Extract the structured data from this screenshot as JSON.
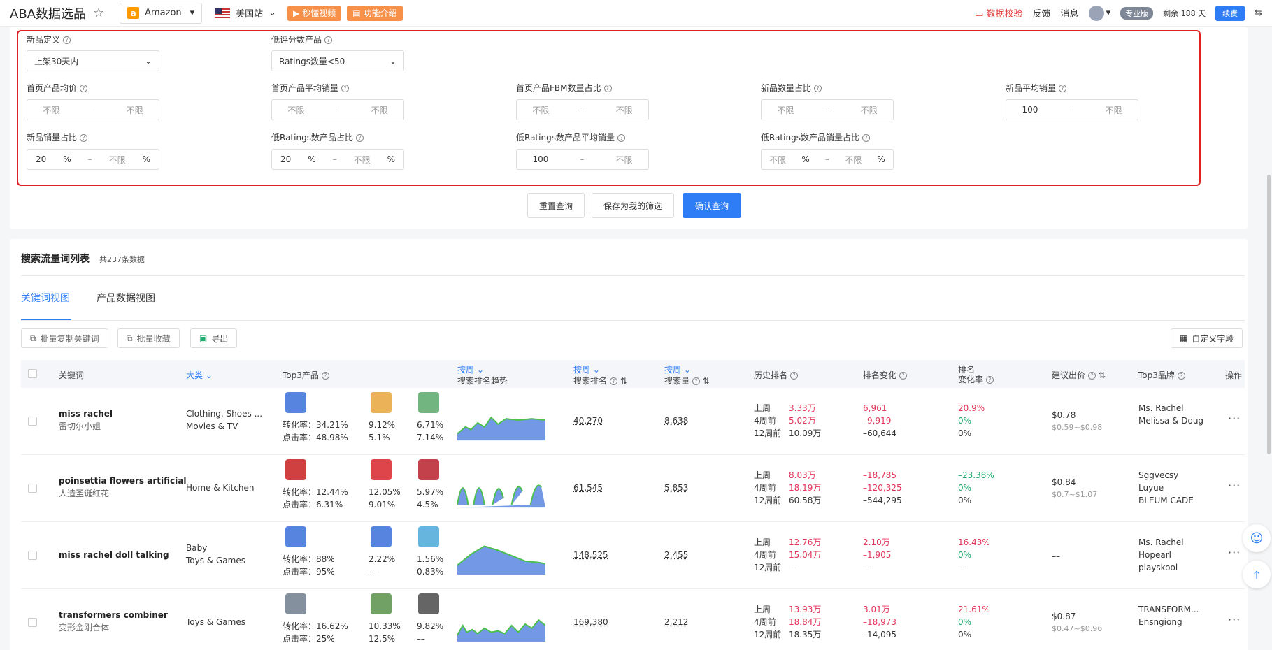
{
  "header": {
    "title": "ABA数据选品",
    "platform": "Amazon",
    "site": "美国站",
    "video_btn": "秒懂视频",
    "intro_btn": "功能介绍",
    "data_check": "数据校验",
    "feedback": "反馈",
    "messages": "消息",
    "plan": "专业版",
    "remaining": "剩余 188 天",
    "renew": "续费"
  },
  "filters": {
    "new_def_label": "新品定义",
    "new_def_value": "上架30天内",
    "low_rating_label": "低评分数产品",
    "low_rating_value": "Ratings数量<50",
    "r1": [
      {
        "label": "首页产品均价",
        "min": "不限",
        "max": "不限"
      },
      {
        "label": "首页产品平均销量",
        "min": "不限",
        "max": "不限"
      },
      {
        "label": "首页产品FBM数量占比",
        "min": "不限",
        "max": "不限"
      },
      {
        "label": "新品数量占比",
        "min": "不限",
        "max": "不限"
      },
      {
        "label": "新品平均销量",
        "min": "100",
        "max": "不限"
      }
    ],
    "r2": [
      {
        "label": "新品销量占比",
        "min": "20",
        "max": "不限",
        "unit": "%"
      },
      {
        "label": "低Ratings数产品占比",
        "min": "20",
        "max": "不限",
        "unit": "%"
      },
      {
        "label": "低Ratings数产品平均销量",
        "min": "100",
        "max": "不限",
        "unit": ""
      },
      {
        "label": "低Ratings数产品销量占比",
        "min": "不限",
        "max": "不限",
        "unit": "%"
      }
    ],
    "sep": "–",
    "reset": "重置查询",
    "save": "保存为我的筛选",
    "confirm": "确认查询"
  },
  "section": {
    "title": "搜索流量词列表",
    "count": "共237条数据",
    "tab1": "关键词视图",
    "tab2": "产品数据视图",
    "copy_btn": "批量复制关键词",
    "fav_btn": "批量收藏",
    "export_btn": "导出",
    "custom_btn": "自定义字段"
  },
  "columns": {
    "keyword": "关键词",
    "category": "大类",
    "top3": "Top3产品",
    "trend_top": "按周",
    "trend": "搜索排名趋势",
    "rank_top": "按周",
    "rank": "搜索排名",
    "vol_top": "按周",
    "vol": "搜索量",
    "history": "历史排名",
    "change": "排名变化",
    "rate_top": "排名",
    "rate": "变化率",
    "bid": "建议出价",
    "brand": "Top3品牌",
    "action": "操作"
  },
  "labels": {
    "conv": "转化率：",
    "click": "点击率：",
    "w1": "上周",
    "w4": "4周前",
    "w12": "12周前"
  },
  "rows": [
    {
      "kw": "miss rachel",
      "kw_cn": "雷切尔小姐",
      "cat1": "Clothing, Shoes ...",
      "cat2": "Movies & TV",
      "conv": [
        "34.21%",
        "9.12%",
        "6.71%"
      ],
      "click": [
        "48.98%",
        "5.1%",
        "7.14%"
      ],
      "rank": "40,270",
      "vol": "8,638",
      "hist": [
        "3.33万",
        "5.02万",
        "10.09万"
      ],
      "chg": [
        "6,961",
        "–9,919",
        "–60,644"
      ],
      "rate": [
        "20.9%",
        "0%",
        "0%"
      ],
      "bid": "$0.78",
      "bid_range": "$0.59~$0.98",
      "brands": [
        "Ms. Rachel",
        "Melissa & Doug",
        ""
      ]
    },
    {
      "kw": "poinsettia flowers artificial",
      "kw_cn": "人造圣诞红花",
      "cat1": "Home & Kitchen",
      "cat2": "",
      "conv": [
        "12.44%",
        "12.05%",
        "5.97%"
      ],
      "click": [
        "6.31%",
        "9.01%",
        "4.5%"
      ],
      "rank": "61,545",
      "vol": "5,853",
      "hist": [
        "8.03万",
        "18.19万",
        "60.58万"
      ],
      "chg": [
        "–18,785",
        "–120,325",
        "–544,295"
      ],
      "rate": [
        "–23.38%",
        "0%",
        "0%"
      ],
      "bid": "$0.84",
      "bid_range": "$0.7~$1.07",
      "brands": [
        "Sggvecsy",
        "Luyue",
        "BLEUM CADE"
      ]
    },
    {
      "kw": "miss rachel doll talking",
      "kw_cn": "",
      "cat1": "Baby",
      "cat2": "Toys & Games",
      "conv": [
        "88%",
        "2.22%",
        "1.56%"
      ],
      "click": [
        "95%",
        "––",
        "0.83%"
      ],
      "rank": "148,525",
      "vol": "2,455",
      "hist": [
        "12.76万",
        "15.04万",
        "––"
      ],
      "chg": [
        "2.10万",
        "–1,905",
        "––"
      ],
      "rate": [
        "16.43%",
        "0%",
        "––"
      ],
      "bid": "––",
      "bid_range": "",
      "brands": [
        "Ms. Rachel",
        "Hopearl",
        "playskool"
      ]
    },
    {
      "kw": "transformers combiner",
      "kw_cn": "变形金刚合体",
      "cat1": "Toys & Games",
      "cat2": "",
      "conv": [
        "16.62%",
        "10.33%",
        "9.82%"
      ],
      "click": [
        "25%",
        "12.5%",
        "––"
      ],
      "rank": "169,380",
      "vol": "2,212",
      "hist": [
        "13.93万",
        "18.84万",
        "18.35万"
      ],
      "chg": [
        "3.01万",
        "–18,973",
        "–14,095"
      ],
      "rate": [
        "21.61%",
        "0%",
        "0%"
      ],
      "bid": "$0.87",
      "bid_range": "$0.47~$0.96",
      "brands": [
        "TRANSFORM...",
        "Ensngiong",
        ""
      ]
    }
  ]
}
